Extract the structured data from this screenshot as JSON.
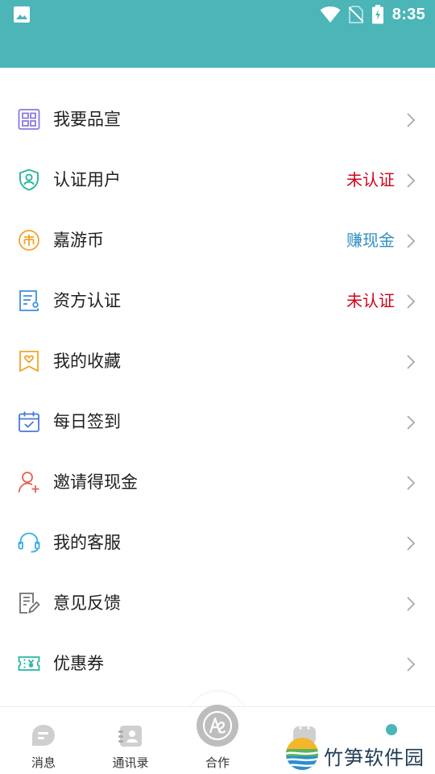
{
  "status_bar": {
    "time": "8:35",
    "icons": [
      "photo-icon",
      "wifi-icon",
      "no-sim-icon",
      "battery-charging-icon"
    ]
  },
  "colors": {
    "header": "#4bb5b8",
    "red_status": "#d0021b",
    "blue_status": "#2e8fbf",
    "chevron": "#a9a9a9",
    "tab_gray": "#bdbdbd"
  },
  "menu": [
    {
      "label": "我要品宣",
      "status": "",
      "icon": "grid-apps-icon"
    },
    {
      "label": "认证用户",
      "status": "未认证",
      "icon": "shield-user-icon"
    },
    {
      "label": "嘉游币",
      "status": "赚现金",
      "icon": "coin-icon"
    },
    {
      "label": "资方认证",
      "status": "未认证",
      "icon": "document-certificate-icon"
    },
    {
      "label": "我的收藏",
      "status": "",
      "icon": "heart-bookmark-icon"
    },
    {
      "label": "每日签到",
      "status": "",
      "icon": "calendar-check-icon"
    },
    {
      "label": "邀请得现金",
      "status": "",
      "icon": "user-add-icon"
    },
    {
      "label": "我的客服",
      "status": "",
      "icon": "headset-icon"
    },
    {
      "label": "意见反馈",
      "status": "",
      "icon": "edit-document-icon"
    },
    {
      "label": "优惠券",
      "status": "",
      "icon": "coupon-icon"
    }
  ],
  "tabs": [
    {
      "label": "消息",
      "icon": "message-icon"
    },
    {
      "label": "通讯录",
      "icon": "contacts-icon"
    },
    {
      "label": "合作",
      "icon": "cooperation-icon"
    }
  ],
  "watermark": {
    "text": "竹笋软件园"
  }
}
